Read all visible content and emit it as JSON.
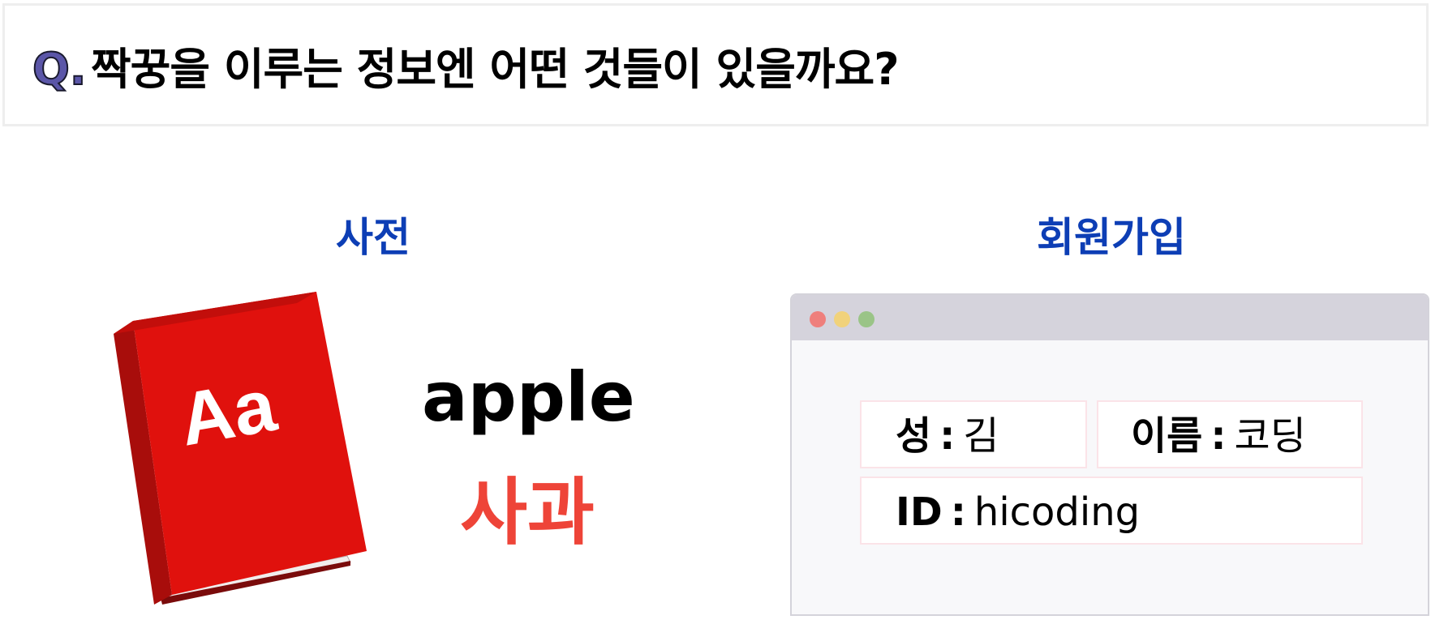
{
  "question": {
    "prefix": "Q.",
    "text": "짝꿍을 이루는 정보엔 어떤 것들이 있을까요?"
  },
  "dictionary": {
    "title": "사전",
    "book_label": "Aa",
    "word_en": "apple",
    "word_ko": "사과"
  },
  "signup": {
    "title": "회원가입",
    "fields": [
      {
        "label": "성",
        "separator": ":",
        "value": "김"
      },
      {
        "label": "이름",
        "separator": ":",
        "value": "코딩"
      },
      {
        "label": "ID",
        "separator": ":",
        "value": "hicoding"
      }
    ]
  },
  "colors": {
    "title_blue": "#0d3eb5",
    "word_red": "#ee4438",
    "book_red": "#e0110d",
    "question_prefix": "#5b56a8"
  },
  "icons": [
    "dictionary-book-icon",
    "window-close-dot-icon",
    "window-minimize-dot-icon",
    "window-maximize-dot-icon"
  ]
}
